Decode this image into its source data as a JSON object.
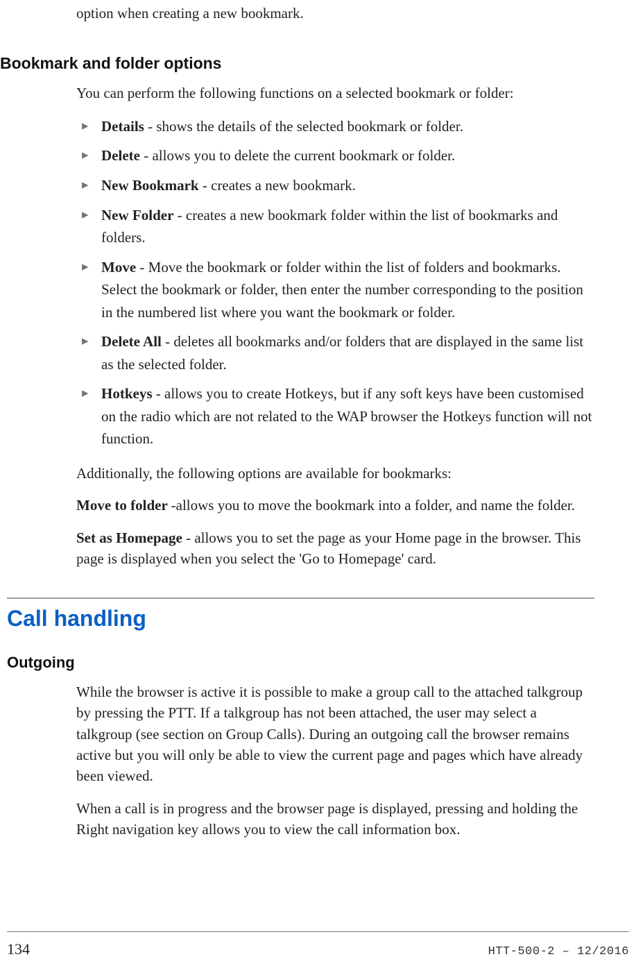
{
  "top_fragment": "option when creating a new bookmark.",
  "section1": {
    "heading": "Bookmark and folder options",
    "intro": "You can perform the following functions on a selected bookmark or folder:",
    "items": [
      {
        "term": "Details",
        "desc": " - shows the details of the selected bookmark or folder."
      },
      {
        "term": "Delete",
        "desc": " - allows you to delete the current bookmark or folder."
      },
      {
        "term": "New Bookmark",
        "desc": " - creates a new bookmark."
      },
      {
        "term": "New Folder",
        "desc": " - creates a new bookmark folder within the list of bookmarks and folders."
      },
      {
        "term": "Move",
        "desc": " - Move the bookmark or folder within the list of folders and bookmarks. Select the bookmark or folder, then enter the number corresponding to the position in the numbered list where you want the bookmark or folder."
      },
      {
        "term": "Delete All",
        "desc": " - deletes all bookmarks and/or folders that are displayed in the same list as the selected folder."
      },
      {
        "term": "Hotkeys",
        "desc": " - allows you to create Hotkeys, but if any soft keys have been customised on the radio which are not related to the WAP browser the Hotkeys function will not function."
      }
    ],
    "additional": "Additionally, the following options are available for bookmarks:",
    "move_to_folder": {
      "term": "Move to folder ",
      "desc": "-allows you to move the bookmark into a folder, and name the folder."
    },
    "set_as_homepage": {
      "term": "Set as Homepage",
      "desc": " - allows you to set the page as your Home page in the browser. This page is displayed when you select the 'Go to Homepage' card."
    }
  },
  "section2": {
    "heading": "Call handling",
    "sub": {
      "heading": "Outgoing",
      "p1": "While the browser is active it is possible to make a group call to the attached talkgroup by pressing the PTT. If a talkgroup has not been attached, the user may select a talkgroup (see section on Group Calls). During an outgoing call the browser remains active but you will only be able to view the current page and pages which have already been viewed.",
      "p2": "When a call is in progress and the browser page is displayed, pressing and holding the Right navigation key allows you to view the call information box."
    }
  },
  "footer": {
    "page_number": "134",
    "doc_id": "HTT-500-2 – 12/2016"
  }
}
